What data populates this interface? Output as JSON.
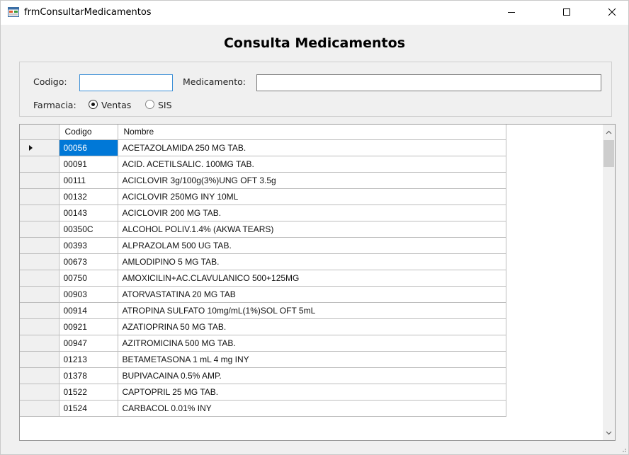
{
  "window": {
    "title": "frmConsultarMedicamentos"
  },
  "heading": "Consulta Medicamentos",
  "filters": {
    "codigo_label": "Codigo:",
    "codigo_value": "",
    "medicamento_label": "Medicamento:",
    "medicamento_value": "",
    "farmacia_label": "Farmacia:",
    "radio_ventas": "Ventas",
    "radio_sis": "SIS",
    "selected": "Ventas"
  },
  "grid": {
    "columns": [
      "Codigo",
      "Nombre"
    ],
    "rows": [
      {
        "codigo": "00056",
        "nombre": "ACETAZOLAMIDA 250 MG TAB."
      },
      {
        "codigo": "00091",
        "nombre": "ACID. ACETILSALIC. 100MG TAB."
      },
      {
        "codigo": "00111",
        "nombre": "ACICLOVIR 3g/100g(3%)UNG OFT 3.5g"
      },
      {
        "codigo": "00132",
        "nombre": "ACICLOVIR 250MG INY 10ML"
      },
      {
        "codigo": "00143",
        "nombre": "ACICLOVIR 200 MG TAB."
      },
      {
        "codigo": "00350C",
        "nombre": "ALCOHOL POLIV.1.4% (AKWA TEARS)"
      },
      {
        "codigo": "00393",
        "nombre": "ALPRAZOLAM 500 UG TAB."
      },
      {
        "codigo": "00673",
        "nombre": "AMLODIPINO 5 MG TAB."
      },
      {
        "codigo": "00750",
        "nombre": "AMOXICILIN+AC.CLAVULANICO 500+125MG"
      },
      {
        "codigo": "00903",
        "nombre": "ATORVASTATINA 20 MG TAB"
      },
      {
        "codigo": "00914",
        "nombre": "ATROPINA SULFATO 10mg/mL(1%)SOL OFT 5mL"
      },
      {
        "codigo": "00921",
        "nombre": "AZATIOPRINA 50 MG TAB."
      },
      {
        "codigo": "00947",
        "nombre": "AZITROMICINA 500 MG TAB."
      },
      {
        "codigo": "01213",
        "nombre": "BETAMETASONA 1 mL 4 mg INY"
      },
      {
        "codigo": "01378",
        "nombre": "BUPIVACAINA 0.5% AMP."
      },
      {
        "codigo": "01522",
        "nombre": "CAPTOPRIL 25 MG TAB."
      },
      {
        "codigo": "01524",
        "nombre": "CARBACOL 0.01% INY"
      }
    ],
    "selected_row": 0
  },
  "colors": {
    "selection": "#0078d7",
    "focus_border": "#3c8fd6"
  }
}
